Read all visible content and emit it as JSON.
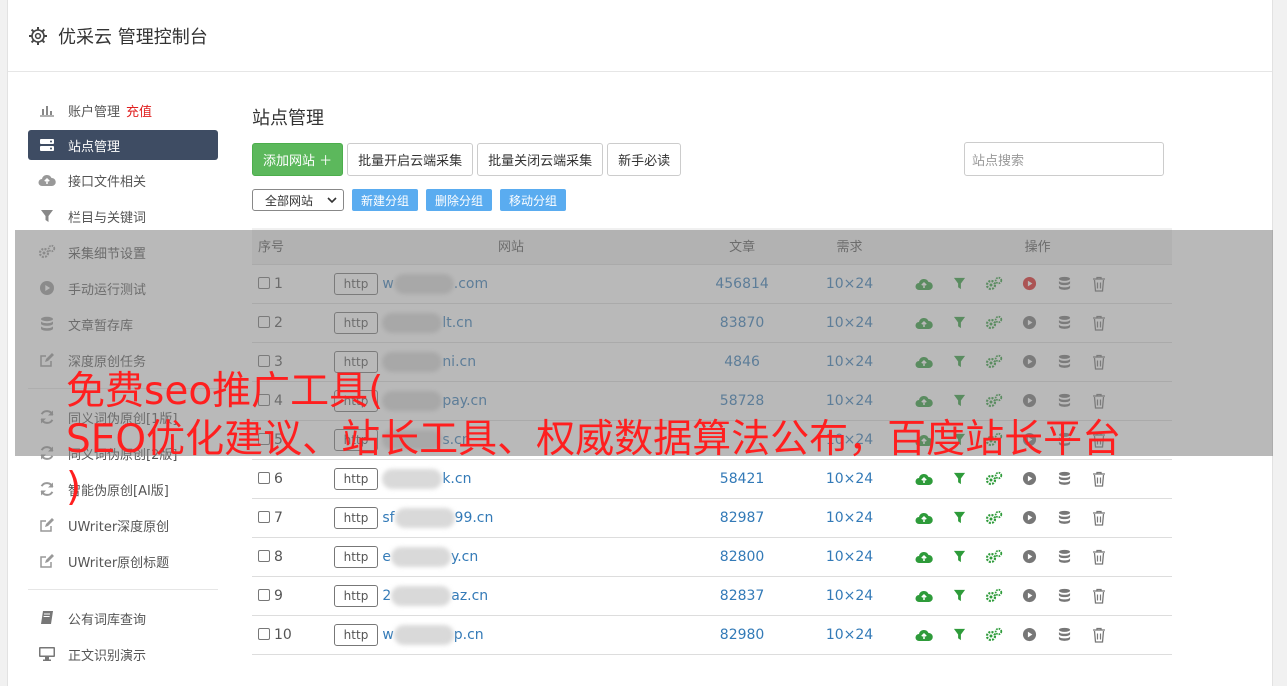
{
  "app": {
    "title": "优采云 管理控制台"
  },
  "sidebar": {
    "items": [
      {
        "label": "账户管理",
        "extra": "充值",
        "icon": "bar-chart-icon"
      },
      {
        "label": "站点管理",
        "icon": "server-icon",
        "active": true
      },
      {
        "label": "接口文件相关",
        "icon": "cloud-upload-icon"
      },
      {
        "label": "栏目与关键词",
        "icon": "filter-icon"
      },
      {
        "label": "采集细节设置",
        "icon": "cogs-icon"
      },
      {
        "label": "手动运行测试",
        "icon": "play-icon"
      },
      {
        "label": "文章暂存库",
        "icon": "database-icon"
      },
      {
        "label": "深度原创任务",
        "icon": "edit-icon"
      },
      {
        "label": "同义词伪原创[1版]",
        "icon": "refresh-icon"
      },
      {
        "label": "同义词伪原创[2版]",
        "icon": "refresh-icon"
      },
      {
        "label": "智能伪原创[AI版]",
        "icon": "refresh-icon"
      },
      {
        "label": "UWriter深度原创",
        "icon": "edit-icon"
      },
      {
        "label": "UWriter原创标题",
        "icon": "edit-icon"
      },
      {
        "label": "公有词库查询",
        "icon": "book-icon"
      },
      {
        "label": "正文识别演示",
        "icon": "monitor-icon"
      }
    ]
  },
  "main": {
    "title": "站点管理",
    "toolbar": {
      "add_site": "添加网站 ＋",
      "batch_open": "批量开启云端采集",
      "batch_close": "批量关闭云端采集",
      "guide": "新手必读",
      "search_placeholder": "站点搜索"
    },
    "group": {
      "select_value": "全部网站",
      "new_group": "新建分组",
      "delete_group": "删除分组",
      "move_group": "移动分组"
    },
    "table": {
      "headers": [
        "序号",
        "网站",
        "文章",
        "需求",
        "操作"
      ],
      "protocol_label": "http",
      "rows": [
        {
          "idx": "1",
          "prefix": "w",
          "suffix": ".com",
          "articles": "456814",
          "req": "10×24",
          "running": true
        },
        {
          "idx": "2",
          "prefix": "",
          "suffix": "lt.cn",
          "articles": "83870",
          "req": "10×24",
          "running": false
        },
        {
          "idx": "3",
          "prefix": "",
          "suffix": "ni.cn",
          "articles": "4846",
          "req": "10×24",
          "running": false
        },
        {
          "idx": "4",
          "prefix": "",
          "suffix": "pay.cn",
          "articles": "58728",
          "req": "10×24",
          "running": false
        },
        {
          "idx": "5",
          "prefix": "",
          "suffix": "s.cn",
          "articles": "",
          "req": "10×24",
          "running": false
        },
        {
          "idx": "6",
          "prefix": "",
          "suffix": "k.cn",
          "articles": "58421",
          "req": "10×24",
          "running": false
        },
        {
          "idx": "7",
          "prefix": "sf",
          "suffix": "99.cn",
          "articles": "82987",
          "req": "10×24",
          "running": false
        },
        {
          "idx": "8",
          "prefix": "e",
          "suffix": "y.cn",
          "articles": "82800",
          "req": "10×24",
          "running": false
        },
        {
          "idx": "9",
          "prefix": "2",
          "suffix": "az.cn",
          "articles": "82837",
          "req": "10×24",
          "running": false
        },
        {
          "idx": "10",
          "prefix": "w",
          "suffix": "p.cn",
          "articles": "82980",
          "req": "10×24",
          "running": false
        }
      ]
    }
  },
  "overlay": {
    "line1": "免费seo推广工具(",
    "line2": "SEO优化建议、站长工具、权威数据算法公布，百度站长平台",
    "line3": ")"
  },
  "colors": {
    "accent_green": "#5cb85c",
    "sidebar_active": "#3e4c63",
    "link_blue": "#337ab7",
    "overlay_red": "#ff1f1f"
  }
}
